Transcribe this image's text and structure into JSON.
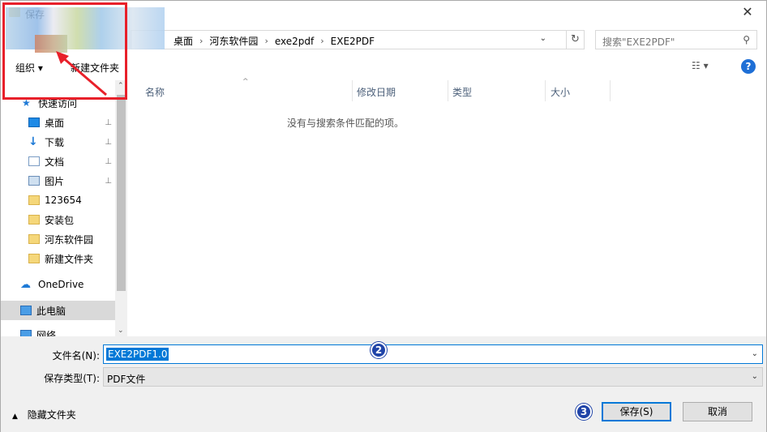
{
  "titlebar": {
    "title": "保存",
    "close": "✕"
  },
  "address": {
    "crumbs": [
      "桌面",
      "河东软件园",
      "exe2pdf",
      "EXE2PDF"
    ],
    "separator": "›",
    "dropdown": "⌄",
    "refresh": "↻",
    "search_placeholder": "搜索\"EXE2PDF\"",
    "search_icon": "⚲"
  },
  "toolbar": {
    "organize": "组织 ▾",
    "new_folder": "新建文件夹",
    "view": "☷ ▾",
    "help": "?"
  },
  "nav": {
    "items": [
      {
        "label": "快速访问",
        "icon": "star-icon"
      },
      {
        "label": "桌面",
        "icon": "desktop-icon",
        "pinned": true
      },
      {
        "label": "下载",
        "icon": "download-icon",
        "pinned": true
      },
      {
        "label": "文档",
        "icon": "document-icon",
        "pinned": true
      },
      {
        "label": "图片",
        "icon": "pictures-icon",
        "pinned": true
      },
      {
        "label": "123654",
        "icon": "folder-icon"
      },
      {
        "label": "安装包",
        "icon": "folder-icon"
      },
      {
        "label": "河东软件园",
        "icon": "folder-icon"
      },
      {
        "label": "新建文件夹",
        "icon": "folder-icon"
      },
      {
        "label": "OneDrive",
        "icon": "cloud-icon"
      },
      {
        "label": "此电脑",
        "icon": "computer-icon",
        "selected": true
      },
      {
        "label": "网络",
        "icon": "network-icon"
      }
    ],
    "pin_glyph": "📌",
    "scroll_up": "⌃",
    "scroll_down": "⌄"
  },
  "content": {
    "columns": [
      "名称",
      "修改日期",
      "类型",
      "大小"
    ],
    "sort_glyph": "^",
    "empty_message": "没有与搜索条件匹配的项。"
  },
  "bottom": {
    "filename_label": "文件名(N):",
    "filename_value": "EXE2PDF1.0",
    "filetype_label": "保存类型(T):",
    "filetype_value": "PDF文件",
    "combo_arrow": "⌄",
    "hide_folders": "隐藏文件夹",
    "hide_caret": "▲",
    "save": "保存(S)",
    "cancel": "取消"
  },
  "annotations": {
    "badge2": "2",
    "badge3": "3"
  },
  "colors": {
    "accent": "#0078d7",
    "annotation_red": "#e8202a",
    "badge_blue": "#2044a8"
  }
}
